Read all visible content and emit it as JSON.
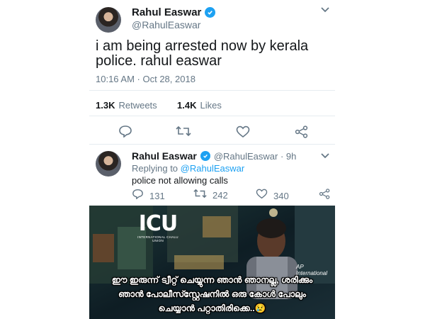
{
  "tweet": {
    "name": "Rahul Easwar",
    "handle": "@RahulEaswar",
    "text_line1": "i am being arrested now by kerala",
    "text_line2": "police.  rahul easwar",
    "timestamp": "10:16 AM · Oct 28, 2018",
    "retweets_count": "1.3K",
    "retweets_label": "Retweets",
    "likes_count": "1.4K",
    "likes_label": "Likes"
  },
  "reply": {
    "name": "Rahul Easwar",
    "handle_time": "@RahulEaswar · 9h",
    "replying_prefix": "Replying to",
    "replying_to": "@RahulEaswar",
    "text": "police not allowing calls",
    "reply_count": "131",
    "retweet_count": "242",
    "like_count": "340"
  },
  "meme": {
    "logo_text": "ICU",
    "logo_subtext": "INTERNATIONAL CHALU UNION",
    "watermark": "AP International",
    "caption_line1": "ഈ ഇരുന്ന് ട്വീറ്റ് ചെയ്യുന്ന ഞാൻ ഞാനല്ല, ശരിക്കും",
    "caption_line2": "ഞാൻ പോലീസ്സ്റ്റേഷനിൽ ഒരു കോൾ പോലും",
    "caption_line3": "ചെയ്യാൻ പറ്റാതിരിക്കെ..😢"
  },
  "colors": {
    "accent": "#1da1f2",
    "muted": "#657786",
    "text": "#14171a"
  }
}
